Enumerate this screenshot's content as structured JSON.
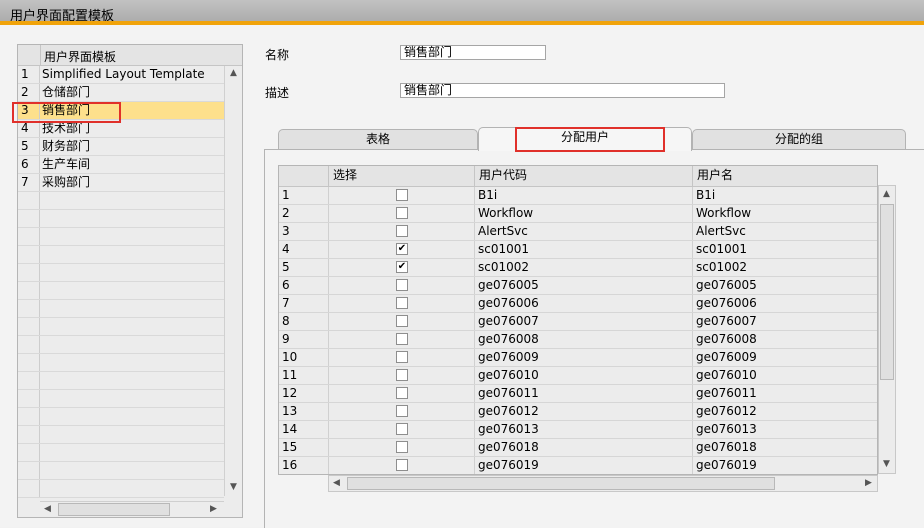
{
  "window": {
    "title": "用户界面配置模板"
  },
  "left_list": {
    "header": "用户界面模板",
    "rows": [
      {
        "num": "1",
        "name": "Simplified Layout Template"
      },
      {
        "num": "2",
        "name": "仓储部门"
      },
      {
        "num": "3",
        "name": "销售部门"
      },
      {
        "num": "4",
        "name": "技术部门"
      },
      {
        "num": "5",
        "name": "财务部门"
      },
      {
        "num": "6",
        "name": "生产车间"
      },
      {
        "num": "7",
        "name": "采购部门"
      }
    ],
    "selected_index": 2
  },
  "form": {
    "name_label": "名称",
    "name_value": "销售部门",
    "desc_label": "描述",
    "desc_value": "销售部门"
  },
  "tabs": [
    {
      "label": "表格"
    },
    {
      "label": "分配用户"
    },
    {
      "label": "分配的组"
    }
  ],
  "active_tab": 1,
  "user_grid": {
    "columns": [
      "",
      "选择",
      "用户代码",
      "用户名"
    ],
    "rows": [
      {
        "num": "1",
        "checked": false,
        "code": "B1i",
        "name": "B1i"
      },
      {
        "num": "2",
        "checked": false,
        "code": "Workflow",
        "name": "Workflow"
      },
      {
        "num": "3",
        "checked": false,
        "code": "AlertSvc",
        "name": "AlertSvc"
      },
      {
        "num": "4",
        "checked": true,
        "code": "sc01001",
        "name": "sc01001"
      },
      {
        "num": "5",
        "checked": true,
        "code": "sc01002",
        "name": "sc01002"
      },
      {
        "num": "6",
        "checked": false,
        "code": "ge076005",
        "name": "ge076005"
      },
      {
        "num": "7",
        "checked": false,
        "code": "ge076006",
        "name": "ge076006"
      },
      {
        "num": "8",
        "checked": false,
        "code": "ge076007",
        "name": "ge076007"
      },
      {
        "num": "9",
        "checked": false,
        "code": "ge076008",
        "name": "ge076008"
      },
      {
        "num": "10",
        "checked": false,
        "code": "ge076009",
        "name": "ge076009"
      },
      {
        "num": "11",
        "checked": false,
        "code": "ge076010",
        "name": "ge076010"
      },
      {
        "num": "12",
        "checked": false,
        "code": "ge076011",
        "name": "ge076011"
      },
      {
        "num": "13",
        "checked": false,
        "code": "ge076012",
        "name": "ge076012"
      },
      {
        "num": "14",
        "checked": false,
        "code": "ge076013",
        "name": "ge076013"
      },
      {
        "num": "15",
        "checked": false,
        "code": "ge076018",
        "name": "ge076018"
      },
      {
        "num": "16",
        "checked": false,
        "code": "ge076019",
        "name": "ge076019"
      }
    ]
  },
  "colors": {
    "accent": "#f0a30a",
    "selected_row": "#fde08c",
    "highlight": "#e0302a"
  }
}
